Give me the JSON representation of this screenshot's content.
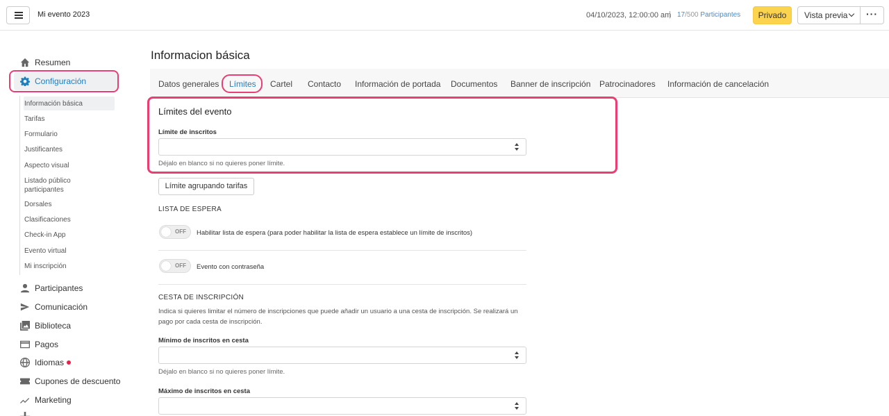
{
  "topbar": {
    "event_title": "Mi evento 2023",
    "datetime": "04/10/2023, 12:00:00 am",
    "separator": "|",
    "participants_count": "17",
    "participants_total": "/500",
    "participants_label": "Participantes",
    "privado_label": "Privado",
    "vista_previa_label": "Vista previa",
    "more_label": "···"
  },
  "sidebar": {
    "resumen": "Resumen",
    "configuracion": "Configuración",
    "sub_items": [
      "Información básica",
      "Tarifas",
      "Formulario",
      "Justificantes",
      "Aspecto visual",
      "Listado público participantes",
      "Dorsales",
      "Clasificaciones",
      "Check-in App",
      "Evento virtual",
      "Mi inscripción"
    ],
    "items": [
      "Participantes",
      "Comunicación",
      "Biblioteca",
      "Pagos",
      "Idiomas",
      "Cupones de descuento",
      "Marketing"
    ]
  },
  "main": {
    "page_title": "Informacion básica",
    "tabs": [
      "Datos generales",
      "Límites",
      "Cartel",
      "Contacto",
      "Información de portada",
      "Documentos",
      "Banner de inscripción",
      "Patrocinadores",
      "Información de cancelación"
    ],
    "limits_title": "Límites del evento",
    "limit_label": "Límite de inscritos",
    "limit_value": "",
    "blank_help": "Déjalo en blanco si no quieres poner límite.",
    "group_limit_button": "Límite agrupando tarifas",
    "waitlist_header": "LISTA DE ESPERA",
    "toggle_off": "OFF",
    "waitlist_toggle_label": "Habilitar lista de espera (para poder habilitar la lista de espera establece un límite de inscritos)",
    "password_toggle_label": "Evento con contraseña",
    "cart_header": "CESTA DE INSCRIPCIÓN",
    "cart_desc": "Indica si quieres limitar el número de inscripciones que puede añadir un usuario a una cesta de inscripción. Se realizará un pago por cada cesta de inscripción.",
    "cart_min_label": "Mínimo de inscritos en cesta",
    "cart_min_help": "Déjalo en blanco si no quieres poner límite.",
    "cart_max_label": "Máximo de inscritos en cesta"
  },
  "colors": {
    "accent": "#1e7fbf",
    "highlight": "#e83e74",
    "privado": "#fcd34d",
    "idiomas_dot": "#e8204e"
  }
}
